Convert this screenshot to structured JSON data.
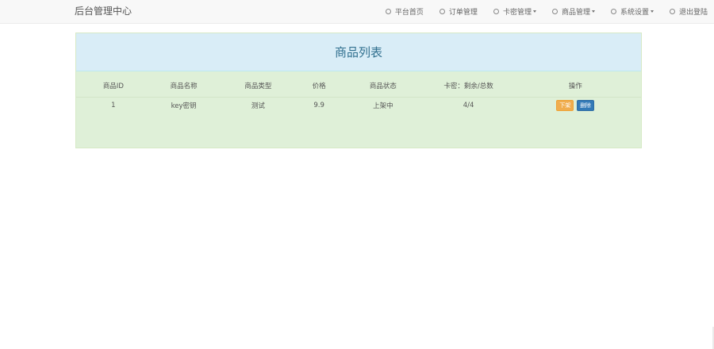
{
  "navbar": {
    "brand": "后台管理中心",
    "items": [
      {
        "label": "平台首页",
        "icon": "circle-icon",
        "dropdown": false
      },
      {
        "label": "订单管理",
        "icon": "circle-icon",
        "dropdown": false
      },
      {
        "label": "卡密管理",
        "icon": "circle-icon",
        "dropdown": true
      },
      {
        "label": "商品管理",
        "icon": "circle-icon",
        "dropdown": true
      },
      {
        "label": "系统设置",
        "icon": "circle-icon",
        "dropdown": true
      },
      {
        "label": "退出登陆",
        "icon": "circle-icon",
        "dropdown": false
      }
    ]
  },
  "panel": {
    "title": "商品列表",
    "columns": [
      "商品ID",
      "商品名称",
      "商品类型",
      "价格",
      "商品状态",
      "卡密：剩余/总数",
      "操作"
    ],
    "rows": [
      {
        "id": "1",
        "name": "key密钥",
        "type": "测试",
        "price": "9.9",
        "status": "上架中",
        "cards": "4/4",
        "actions": {
          "off_shelf": "下架",
          "delete": "删除"
        }
      }
    ]
  },
  "colors": {
    "panel_heading_bg": "#d9edf7",
    "panel_body_bg": "#dff0d8",
    "warning_button": "#f0ad4e",
    "primary_button": "#337ab7"
  }
}
